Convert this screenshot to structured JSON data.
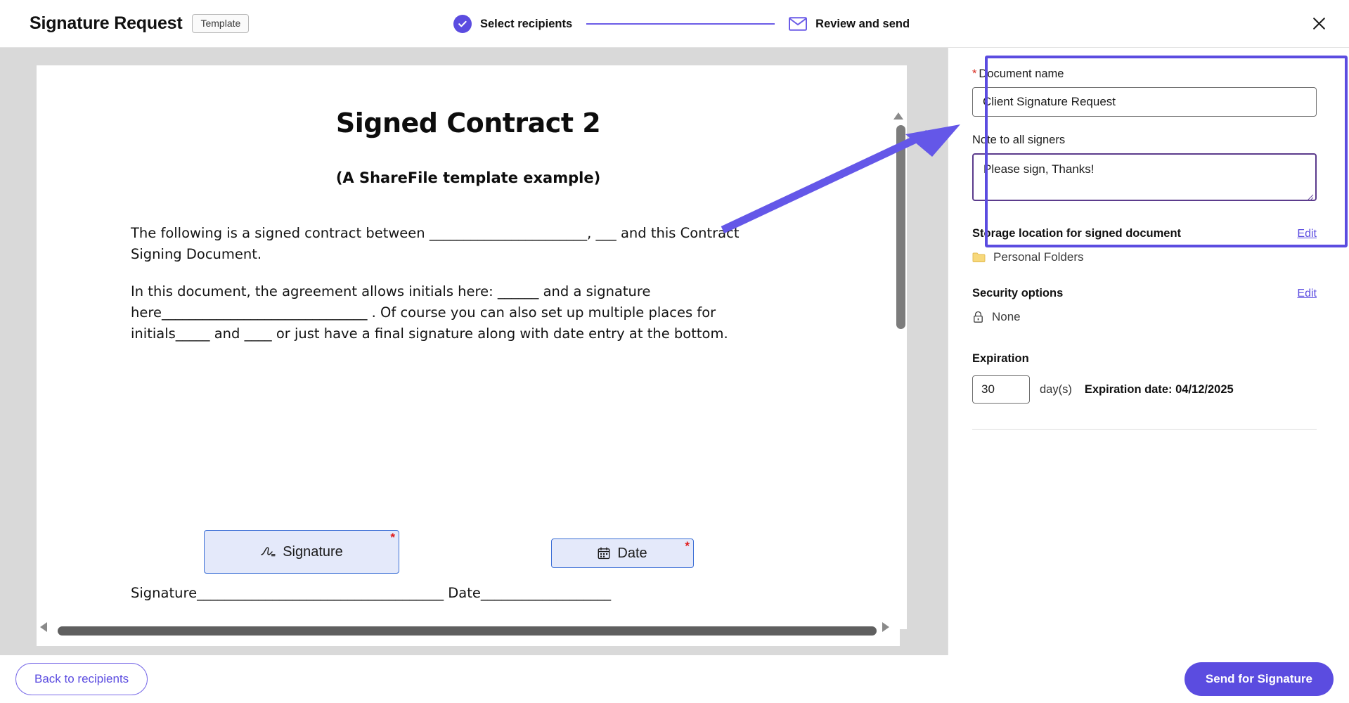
{
  "header": {
    "title": "Signature Request",
    "template_badge": "Template",
    "close_icon": "close-icon",
    "steps": [
      {
        "label": "Select recipients",
        "icon": "check-circle-icon",
        "state": "completed"
      },
      {
        "label": "Review and send",
        "icon": "mail-icon",
        "state": "current"
      }
    ]
  },
  "document": {
    "heading": "Signed Contract 2",
    "subheading": "(A ShareFile template example)",
    "paragraph_1": "The following is a signed contract between _______________________, ___ and this Contract Signing Document.",
    "paragraph_2": "In this document, the agreement allows initials here: ______ and a signature here______________________________ . Of course you can also set up multiple places for initials_____ and ____ or just have a final signature along with date entry at the bottom.",
    "signature_line": "Signature____________________________________ Date___________________",
    "fields": [
      {
        "label": "Signature",
        "icon": "signature-icon",
        "required_marker": "*"
      },
      {
        "label": "Date",
        "icon": "calendar-icon",
        "required_marker": "*"
      }
    ]
  },
  "side_panel": {
    "document_name": {
      "label": "Document name",
      "required_marker": "*",
      "value": "Client Signature Request",
      "placeholder": "Document name"
    },
    "note": {
      "label": "Note to all signers",
      "value": "Please sign, Thanks!",
      "placeholder": "Note to all signers"
    },
    "storage": {
      "title": "Storage location for signed document",
      "edit_label": "Edit",
      "value": "Personal Folders",
      "icon": "folder-icon"
    },
    "security": {
      "title": "Security options",
      "edit_label": "Edit",
      "value": "None",
      "icon": "lock-icon"
    },
    "expiration": {
      "title": "Expiration",
      "days_value": "30",
      "days_label": "day(s)",
      "date_text": "Expiration date: 04/12/2025"
    }
  },
  "footer": {
    "back_label": "Back to recipients",
    "send_label": "Send for Signature"
  },
  "colors": {
    "accent": "#5b4ce0",
    "required": "#d93025",
    "field_fill": "#e4e9fa",
    "field_border": "#3c6fd6"
  }
}
